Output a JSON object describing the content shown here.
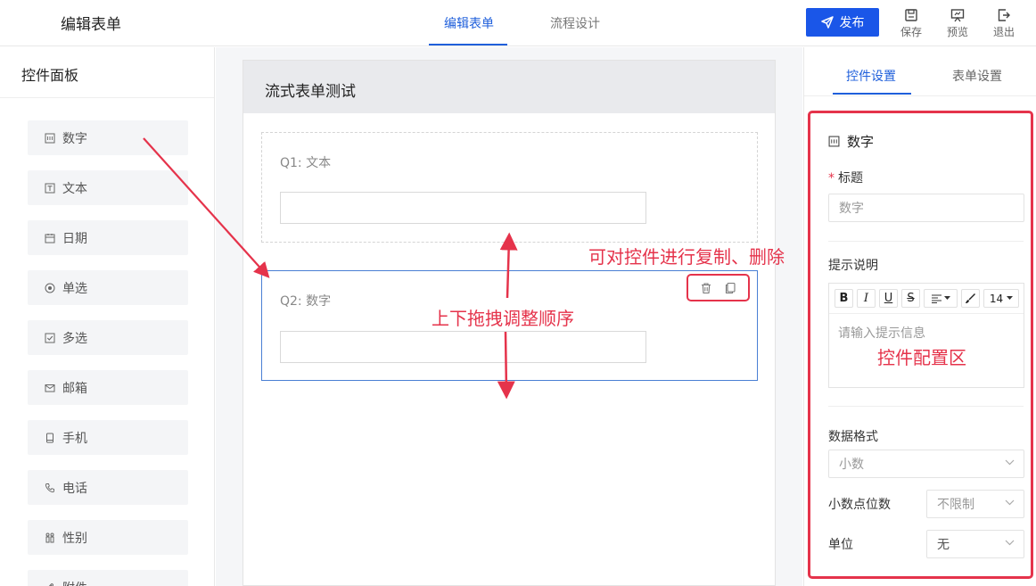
{
  "header": {
    "title": "编辑表单",
    "tabs": [
      {
        "label": "编辑表单",
        "active": true
      },
      {
        "label": "流程设计",
        "active": false
      }
    ],
    "publish_label": "发布",
    "tools": [
      {
        "label": "保存",
        "icon": "save-icon"
      },
      {
        "label": "预览",
        "icon": "preview-icon"
      },
      {
        "label": "退出",
        "icon": "exit-icon"
      }
    ]
  },
  "left_panel": {
    "title": "控件面板",
    "controls": [
      {
        "label": "数字",
        "icon": "number-icon"
      },
      {
        "label": "文本",
        "icon": "text-icon"
      },
      {
        "label": "日期",
        "icon": "calendar-icon"
      },
      {
        "label": "单选",
        "icon": "radio-icon"
      },
      {
        "label": "多选",
        "icon": "checkbox-icon"
      },
      {
        "label": "邮箱",
        "icon": "mail-icon"
      },
      {
        "label": "手机",
        "icon": "mobile-icon"
      },
      {
        "label": "电话",
        "icon": "phone-icon"
      },
      {
        "label": "性别",
        "icon": "gender-icon"
      },
      {
        "label": "附件",
        "icon": "attachment-icon"
      }
    ]
  },
  "form": {
    "title": "流式表单测试",
    "questions": [
      {
        "label": "Q1: 文本",
        "value": ""
      },
      {
        "label": "Q2: 数字",
        "value": ""
      }
    ]
  },
  "right_panel": {
    "tabs": [
      {
        "label": "控件设置",
        "active": true
      },
      {
        "label": "表单设置",
        "active": false
      }
    ],
    "control_name": "数字",
    "title_label": "标题",
    "title_required_mark": "*",
    "title_placeholder": "数字",
    "hint_label": "提示说明",
    "editor": {
      "bold": "B",
      "italic": "I",
      "underline": "U",
      "strike": "S",
      "font_size": "14",
      "placeholder": "请输入提示信息"
    },
    "format_label": "数据格式",
    "format_value": "小数",
    "decimals_label": "小数点位数",
    "decimals_value": "不限制",
    "unit_label": "单位",
    "unit_value": "无"
  },
  "annotations": {
    "copy_delete": "可对控件进行复制、删除",
    "drag_sort": "上下拖拽调整顺序",
    "config_area": "控件配置区"
  },
  "colors": {
    "accent": "#1f5fdb",
    "publish": "#1a56e8",
    "annotation": "#e5334b"
  }
}
